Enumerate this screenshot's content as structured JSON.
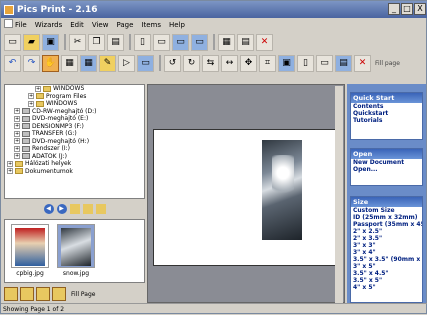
{
  "window": {
    "title": "Pics Print - 2.16",
    "min": "_",
    "max": "□",
    "close": "X"
  },
  "menu": [
    "File",
    "Wizards",
    "Edit",
    "View",
    "Page",
    "Items",
    "Help"
  ],
  "toolbar": {
    "fill_page_label": "Fill page"
  },
  "tree": [
    {
      "label": "WINDOWS",
      "indent": 4,
      "type": "folder"
    },
    {
      "label": "Program Files",
      "indent": 3,
      "type": "folder"
    },
    {
      "label": "WINDOWS",
      "indent": 3,
      "type": "folder"
    },
    {
      "label": "CD-RW-meghajtó (D:)",
      "indent": 1,
      "type": "drive"
    },
    {
      "label": "DVD-meghajtó (E:)",
      "indent": 1,
      "type": "drive"
    },
    {
      "label": "DENSIONMP3 (F:)",
      "indent": 1,
      "type": "drive"
    },
    {
      "label": "TRANSFER (G:)",
      "indent": 1,
      "type": "drive"
    },
    {
      "label": "DVD-meghajtó (H:)",
      "indent": 1,
      "type": "drive"
    },
    {
      "label": "Rendszer (I:)",
      "indent": 1,
      "type": "drive"
    },
    {
      "label": "ADATOK (J:)",
      "indent": 1,
      "type": "drive"
    },
    {
      "label": "Hálózati helyek",
      "indent": 0,
      "type": "folder"
    },
    {
      "label": "Dokumentumok",
      "indent": 0,
      "type": "folder"
    }
  ],
  "thumbnails": [
    {
      "name": "cpbig.jpg"
    },
    {
      "name": "snow.jpg"
    }
  ],
  "bottom_toolbar": {
    "fill_page": "Fill Page"
  },
  "status": "Showing Page 1 of 2",
  "quick_start": {
    "title": "Quick Start",
    "items": [
      "Contents",
      "Quickstart",
      "Tutorials"
    ]
  },
  "open": {
    "title": "Open",
    "items": [
      "New Document",
      "Open..."
    ]
  },
  "size": {
    "title": "Size",
    "items": [
      "Custom Size",
      "ID (25mm x 32mm)",
      "Passport (35mm x 45",
      "2\" x 2.5\"",
      "2\" x 3.5\"",
      "3\" x 3\"",
      "3\" x 4\"",
      "3.5\" x 3.5\" (90mm x 9",
      "3\" x 5\"",
      "3.5\" x 4.5\"",
      "3.5\" x 5\"",
      "4\" x 5\""
    ]
  },
  "colors": {
    "titlebar": "#4a64a0",
    "panel_header": "#3a64b8",
    "workspace": "#8a8c94"
  }
}
